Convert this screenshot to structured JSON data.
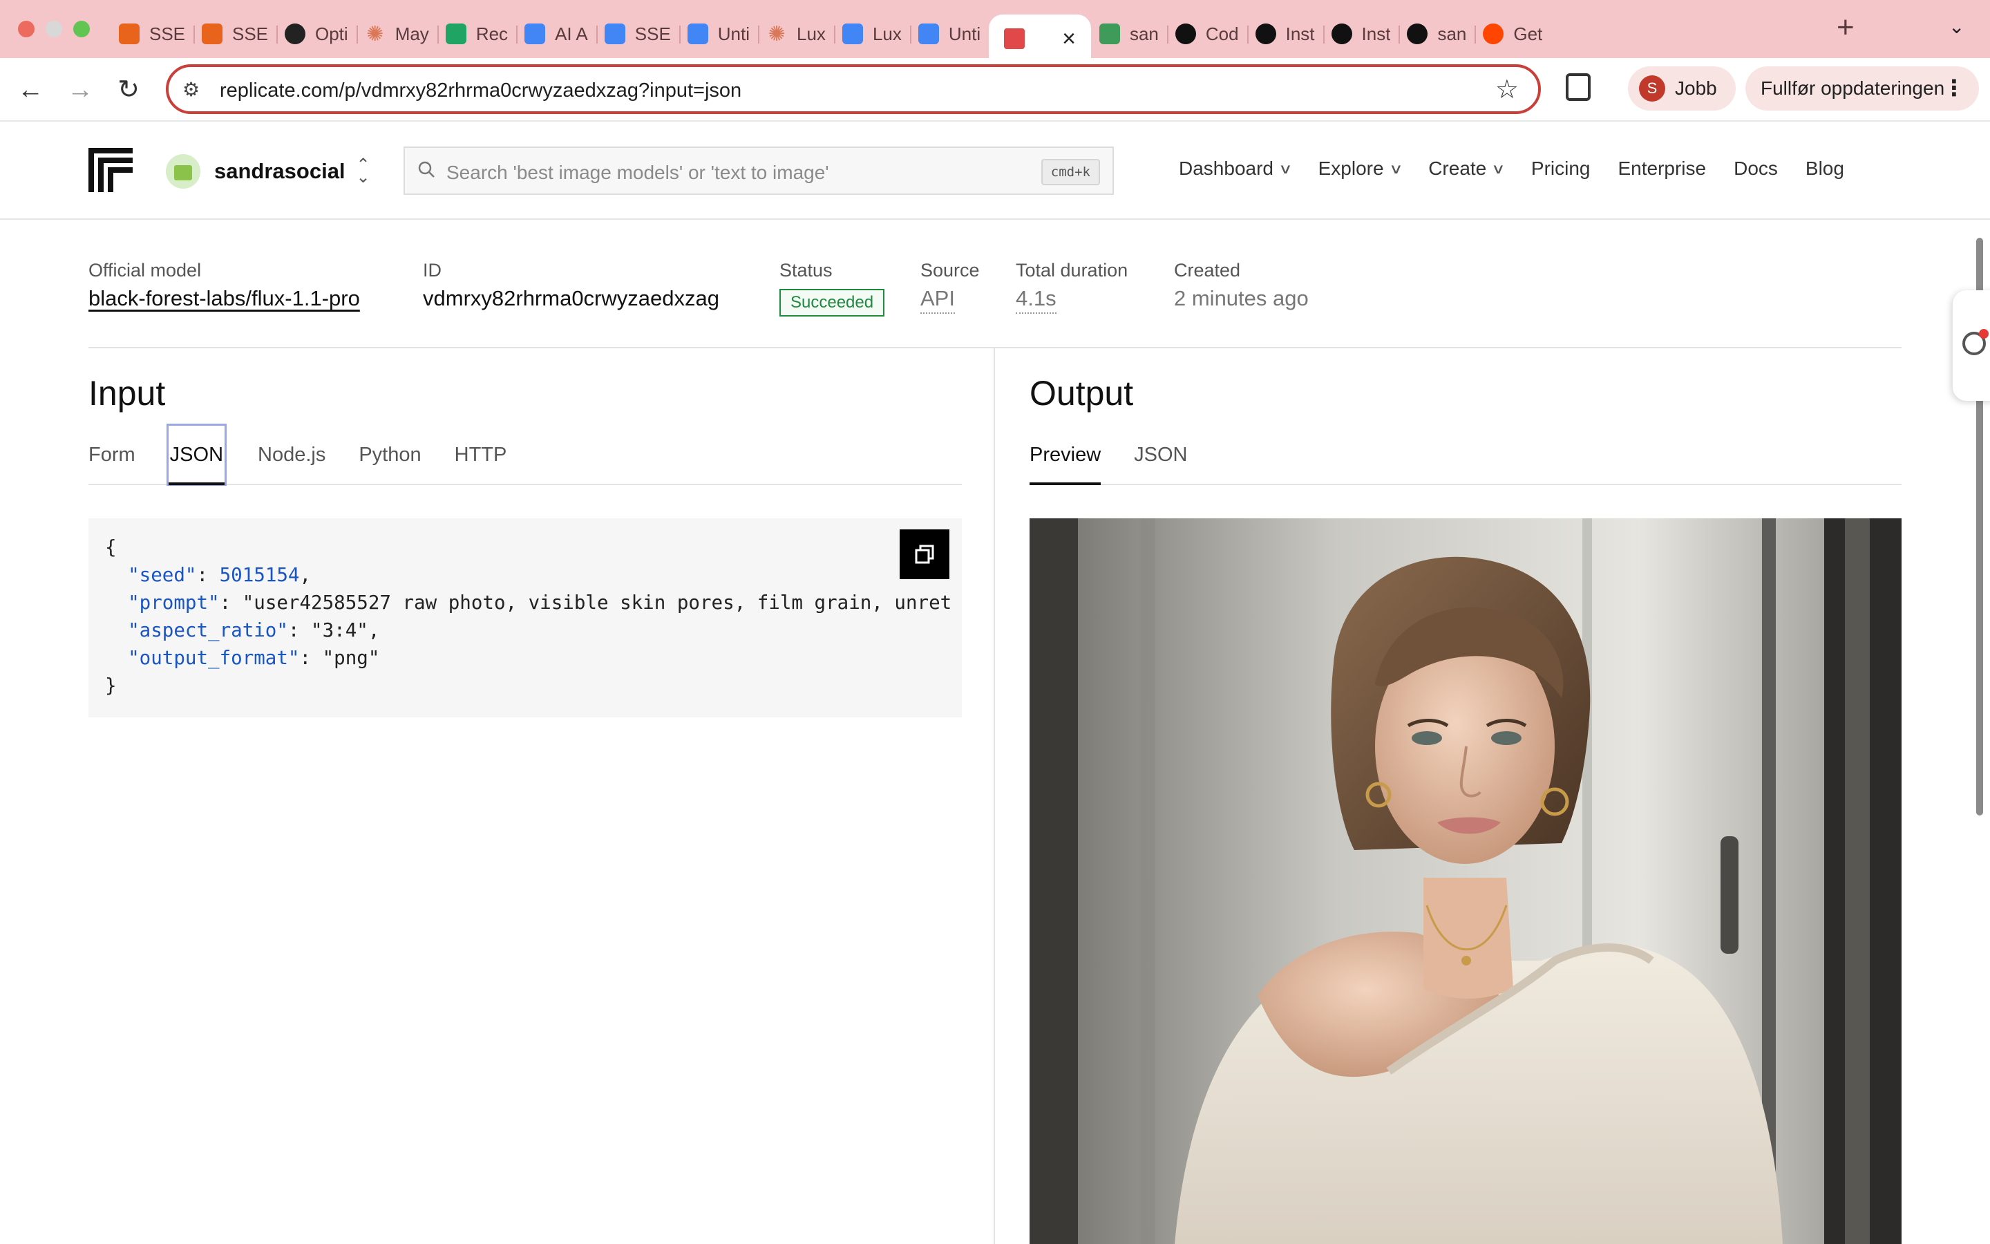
{
  "browser": {
    "tabs": [
      {
        "label": "SSE",
        "icon": "orange-blocks-icon",
        "color": "#e8631c"
      },
      {
        "label": "SSE",
        "icon": "orange-blocks-icon",
        "color": "#e8631c"
      },
      {
        "label": "Opti",
        "icon": "openai-icon",
        "color": "#222222"
      },
      {
        "label": "May",
        "icon": "claude-asterisk-icon",
        "color": "#d97757"
      },
      {
        "label": "Rec",
        "icon": "google-drive-icon",
        "color": "#1fa463"
      },
      {
        "label": "AI A",
        "icon": "google-docs-icon",
        "color": "#4285f4"
      },
      {
        "label": "SSE",
        "icon": "google-docs-icon",
        "color": "#4285f4"
      },
      {
        "label": "Unti",
        "icon": "google-docs-icon",
        "color": "#4285f4"
      },
      {
        "label": "Lux",
        "icon": "claude-asterisk-icon",
        "color": "#d97757"
      },
      {
        "label": "Lux",
        "icon": "google-docs-icon",
        "color": "#4285f4"
      },
      {
        "label": "Unti",
        "icon": "google-docs-icon",
        "color": "#4285f4"
      },
      {
        "label": "",
        "icon": "replicate-icon",
        "color": "#e0484a",
        "active": true
      },
      {
        "label": "san",
        "icon": "green-square-icon",
        "color": "#3e9b5a"
      },
      {
        "label": "Cod",
        "icon": "github-icon",
        "color": "#111111"
      },
      {
        "label": "Inst",
        "icon": "github-icon",
        "color": "#111111"
      },
      {
        "label": "Inst",
        "icon": "github-icon",
        "color": "#111111"
      },
      {
        "label": "san",
        "icon": "github-icon",
        "color": "#111111"
      },
      {
        "label": "Get",
        "icon": "reddit-icon",
        "color": "#ff4500"
      }
    ],
    "url": "replicate.com/p/vdmrxy82rhrma0crwyzaedxzag?input=json",
    "profile_initial": "S",
    "profile_label": "Jobb",
    "update_label": "Fullfør oppdateringen"
  },
  "header": {
    "account_name": "sandrasocial",
    "search_placeholder": "Search 'best image models' or 'text to image'",
    "search_shortcut": "cmd+k",
    "nav": [
      {
        "label": "Dashboard",
        "dropdown": true
      },
      {
        "label": "Explore",
        "dropdown": true
      },
      {
        "label": "Create",
        "dropdown": true
      },
      {
        "label": "Pricing",
        "dropdown": false
      },
      {
        "label": "Enterprise",
        "dropdown": false
      },
      {
        "label": "Docs",
        "dropdown": false
      },
      {
        "label": "Blog",
        "dropdown": false
      }
    ]
  },
  "prediction": {
    "model_label": "Official model",
    "model_value": "black-forest-labs/flux-1.1-pro",
    "id_label": "ID",
    "id_value": "vdmrxy82rhrma0crwyzaedxzag",
    "status_label": "Status",
    "status_value": "Succeeded",
    "source_label": "Source",
    "source_value": "API",
    "duration_label": "Total duration",
    "duration_value": "4.1s",
    "created_label": "Created",
    "created_value": "2 minutes ago"
  },
  "input": {
    "title": "Input",
    "tabs": [
      "Form",
      "JSON",
      "Node.js",
      "Python",
      "HTTP"
    ],
    "active_tab": "JSON",
    "json": {
      "open": "{",
      "lines": [
        {
          "key": "\"seed\"",
          "value": "5015154",
          "value_type": "number",
          "trail": ","
        },
        {
          "key": "\"prompt\"",
          "value": "\"user42585527 raw photo, visible skin pores, film grain, unret",
          "value_type": "string",
          "trail": ""
        },
        {
          "key": "\"aspect_ratio\"",
          "value": "\"3:4\"",
          "value_type": "string",
          "trail": ","
        },
        {
          "key": "\"output_format\"",
          "value": "\"png\"",
          "value_type": "string",
          "trail": ""
        }
      ],
      "close": "}"
    }
  },
  "output": {
    "title": "Output",
    "tabs": [
      "Preview",
      "JSON"
    ],
    "active_tab": "Preview"
  },
  "colors": {
    "tabstrip": "#f4c6c9",
    "omnibox_border": "#c9403a",
    "status_green": "#1f8a3f",
    "json_key": "#1a55c4"
  }
}
